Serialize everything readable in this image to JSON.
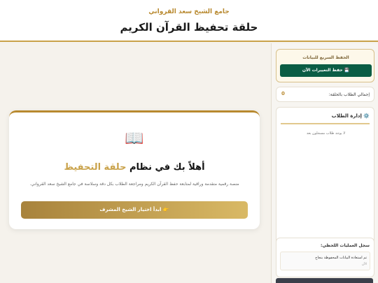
{
  "header": {
    "mosque_name": "جامع الشيخ سعد القرواني",
    "title": "حلقة تحفيظ القرآن الكريم"
  },
  "sidebar": {
    "quick_save": {
      "title": "الحفظ السريع للبيانات",
      "button_label": "💾 حفظ التغييرات الآن"
    },
    "total_students": {
      "label": "إجمالي الطلاب بالحلقة:",
      "value": "0"
    },
    "student_management": {
      "heading": "⚙️ إدارة الطلاب",
      "empty_message": "لا يوجد طلاب مسجلون بعد"
    },
    "activity_log": {
      "heading": "سجل العمليات اللحظي:",
      "entries": [
        {
          "text": "تم استعادة البيانات المحفوظة بنجاح",
          "time": "الآن"
        }
      ]
    }
  },
  "welcome": {
    "icon": "📖",
    "title_prefix": "أهلاً بك في نظام",
    "title_highlight": "حلقة التحفيظ",
    "subtitle": "منصة رقمية متقدمة وراقية لمتابعة حفظ القرآن الكريم ومراجعة الطلاب بكل دقة وسلاسة في جامع الشيخ سعد القرواني.",
    "button_label": "👉 ابدأ اختيار الشيخ المشرف"
  },
  "colors": {
    "accent_gold": "#c9a24a",
    "primary_green": "#0b5d44"
  }
}
